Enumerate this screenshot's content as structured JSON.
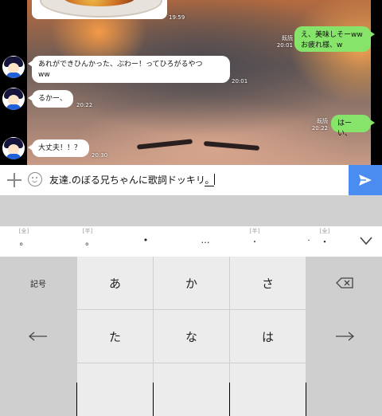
{
  "chat": {
    "messages": [
      {
        "side": "left",
        "text": "",
        "time": "19:59"
      },
      {
        "side": "right",
        "text": "え、美味しそーww\nお疲れ様、w",
        "time": "20:01",
        "read": "既読"
      },
      {
        "side": "left",
        "text": "あれができひんかった、ぶわー！ってひろがるやつ\nww",
        "time": "20:01"
      },
      {
        "side": "left",
        "text": "るかー、",
        "time": "20:22"
      },
      {
        "side": "right",
        "text": "はーい、",
        "time": "20:22",
        "read": "既読"
      },
      {
        "side": "left",
        "text": "大丈夫！！？",
        "time": "20:30"
      }
    ]
  },
  "composer": {
    "text": "友達.のぼる兄ちゃんに歌詞ドッキリ",
    "composing": "。",
    "icons": [
      "plus-icon",
      "emoji-icon",
      "send-icon"
    ],
    "send_color": "#4b8cf0"
  },
  "keyboard": {
    "candidates": [
      {
        "tag": "[全]",
        "symbol": "。"
      },
      {
        "tag": "[半]",
        "symbol": "｡"
      },
      {
        "tag": "",
        "symbol": "•"
      },
      {
        "tag": "",
        "symbol": "…"
      },
      {
        "tag": "[半]",
        "symbol": "･"
      },
      {
        "tag": "",
        "symbol": "·"
      },
      {
        "tag": "[全]",
        "symbol": "・"
      }
    ],
    "keys": {
      "kigou": "記号",
      "a": "あ",
      "ka": "か",
      "sa": "さ",
      "ta": "た",
      "na": "な",
      "ha": "は"
    }
  }
}
